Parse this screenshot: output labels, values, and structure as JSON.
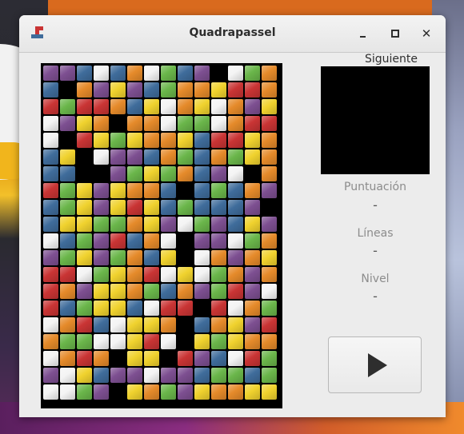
{
  "window": {
    "title": "Quadrapassel"
  },
  "side": {
    "next_label": "Siguiente",
    "score_label": "Puntuación",
    "score_value": "-",
    "lines_label": "Líneas",
    "lines_value": "-",
    "level_label": "Nivel",
    "level_value": "-"
  },
  "icons": {
    "app": "quadrapassel-app-icon",
    "minimize": "minimize-icon",
    "maximize": "maximize-icon",
    "close": "close-icon",
    "play": "play-icon"
  },
  "colors": {
    "P": "#7d4f91",
    "B": "#3f6c9b",
    "W": "#f4f4f4",
    "O": "#e58a2a",
    "G": "#6ab64a",
    "Y": "#f0d22e",
    "R": "#c93434",
    "K": "#000000"
  },
  "board": {
    "cols": 14,
    "rows": 20,
    "grid": [
      "PPBWBOWGBPKWGO",
      "BKOPYPBGOOYRRO",
      "RGRROBYWOYWOPY",
      "WPYOKOOWGGWORR",
      "WKRYGYOOYBRRYO",
      "BYKWPPBOGBOGYO",
      "BBKKPGYGOBPWKO",
      "RGYPYOOBKBGBOP",
      "BGYPYRYBGBBBPK",
      "BYYGGOYPWGPBYP",
      "WBGPRBOWKPPWGO",
      "PGYPGOBYKWOPOY",
      "RRWGYORWYWGOPO",
      "ROPYYOGBOPGRPW",
      "RBGYYBWRRKRWOG",
      "WORBWYYOKBOYPR",
      "OGGWWYRWKYGYOO",
      "WOROKYYKRPBWRG",
      "PWYBPPWPPBGGBG",
      "WWGPKYOGPYOOYY"
    ]
  }
}
